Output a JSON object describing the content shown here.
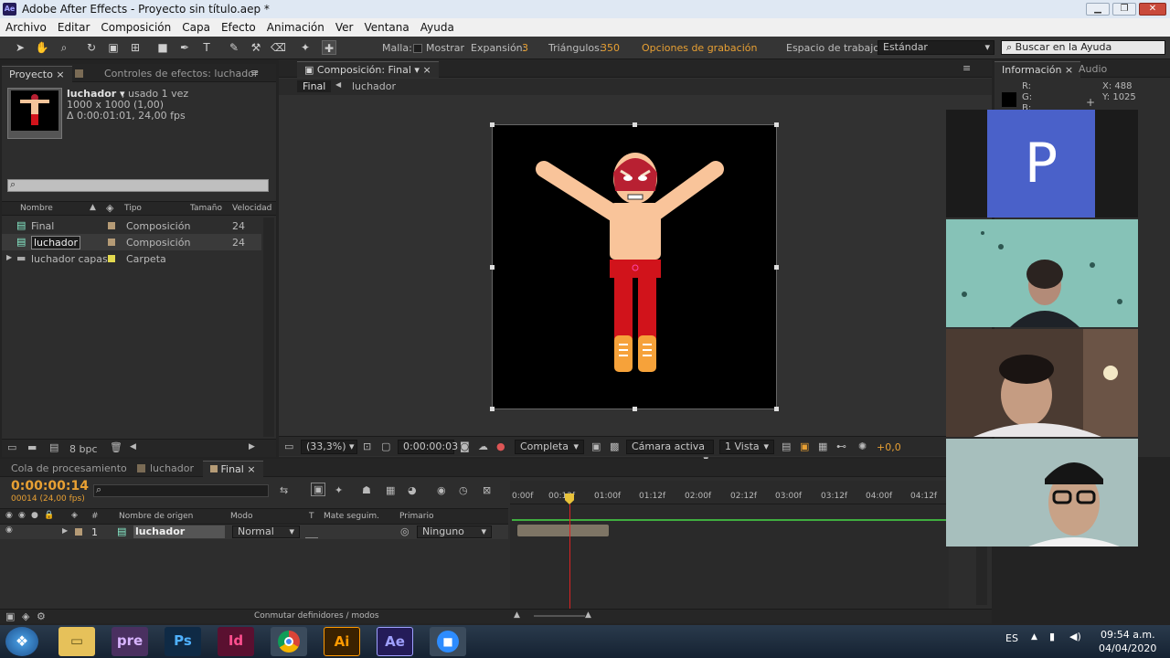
{
  "window": {
    "title": "Adobe After Effects - Proyecto sin título.aep *",
    "app_badge": "Ae"
  },
  "menu": [
    "Archivo",
    "Editar",
    "Composición",
    "Capa",
    "Efecto",
    "Animación",
    "Ver",
    "Ventana",
    "Ayuda"
  ],
  "toolbar": {
    "malla_label": "Malla:",
    "mostrar_label": "Mostrar",
    "expansion_label": "Expansión:",
    "expansion_value": "3",
    "triangulos_label": "Triángulos:",
    "triangulos_value": "350",
    "opciones_grabacion": "Opciones de grabación",
    "espacio_label": "Espacio de trabajo:",
    "espacio_value": "Estándar",
    "search_placeholder": "Buscar en la Ayuda"
  },
  "project_panel": {
    "tab_project": "Proyecto",
    "tab_effects": "Controles de efectos: luchador",
    "item_name": "luchador ▾",
    "item_used": ", usado 1 vez",
    "item_size": "1000 x 1000 (1,00)",
    "item_duration": "Δ 0:00:01:01, 24,00 fps",
    "columns": {
      "name": "Nombre",
      "type": "Tipo",
      "size": "Tamaño",
      "speed": "Velocidad"
    },
    "rows": [
      {
        "name": "Final",
        "type": "Composición",
        "value": "24",
        "color": "#b59b76"
      },
      {
        "name": "luchador",
        "type": "Composición",
        "value": "24",
        "color": "#b59b76"
      },
      {
        "name": "luchador capas",
        "type": "Carpeta",
        "value": "",
        "color": "#e3d94f"
      }
    ],
    "bpc": "8 bpc"
  },
  "composition_panel": {
    "tab": "Composición: Final",
    "breadcrumb_final": "Final",
    "breadcrumb_luchador": "luchador",
    "zoom": "(33,3%)",
    "timecode": "0:00:00:03",
    "resolution": "Completa",
    "camera": "Cámara activa",
    "views": "1 Vista",
    "exposure": "+0,0"
  },
  "info_panel": {
    "tab_info": "Información",
    "tab_audio": "Audio",
    "r_label": "R:",
    "g_label": "G:",
    "b_label": "B:",
    "x_label": "X: 488",
    "y_label": "Y: 1025"
  },
  "timeline": {
    "tab_render": "Cola de procesamiento",
    "tab_luchador": "luchador",
    "tab_final": "Final",
    "timecode": "0:00:00:14",
    "fps_info": "00014 (24,00 fps)",
    "columns": {
      "hash": "#",
      "source": "Nombre de origen",
      "mode": "Modo",
      "t": "T",
      "mate": "Mate seguim.",
      "parent": "Primario"
    },
    "layer": {
      "index": "1",
      "name": "luchador",
      "mode": "Normal",
      "parent": "Ninguno"
    },
    "ruler": [
      "0:00f",
      "00:12f",
      "01:00f",
      "01:12f",
      "02:00f",
      "02:12f",
      "03:00f",
      "03:12f",
      "04:00f",
      "04:12f"
    ],
    "toggle_label": "Conmutar definidores / modos"
  },
  "meeting": {
    "participant_initial": "P"
  },
  "taskbar": {
    "apps": [
      "pre",
      "Ps",
      "Id",
      "Chrome",
      "Ai",
      "Ae",
      "Zoom"
    ],
    "lang": "ES",
    "time": "09:54 a.m.",
    "date": "04/04/2020"
  }
}
